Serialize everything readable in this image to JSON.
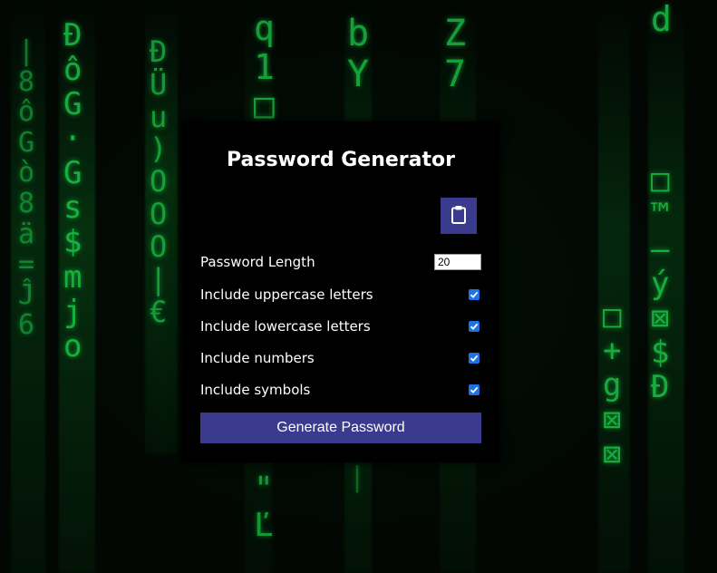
{
  "app": {
    "title": "Password Generator"
  },
  "clipboard_button": {
    "icon": "clipboard-icon"
  },
  "settings": {
    "length_label": "Password Length",
    "length_value": "20",
    "options": [
      {
        "label": "Include uppercase letters",
        "checked": true
      },
      {
        "label": "Include lowercase letters",
        "checked": true
      },
      {
        "label": "Include numbers",
        "checked": true
      },
      {
        "label": "Include symbols",
        "checked": true
      }
    ]
  },
  "generate_button": {
    "label": "Generate Password"
  },
  "colors": {
    "accent": "#3a3a8e",
    "checkbox": "#1c73e8",
    "card_bg": "#000000",
    "matrix_green": "#1bd14a"
  }
}
